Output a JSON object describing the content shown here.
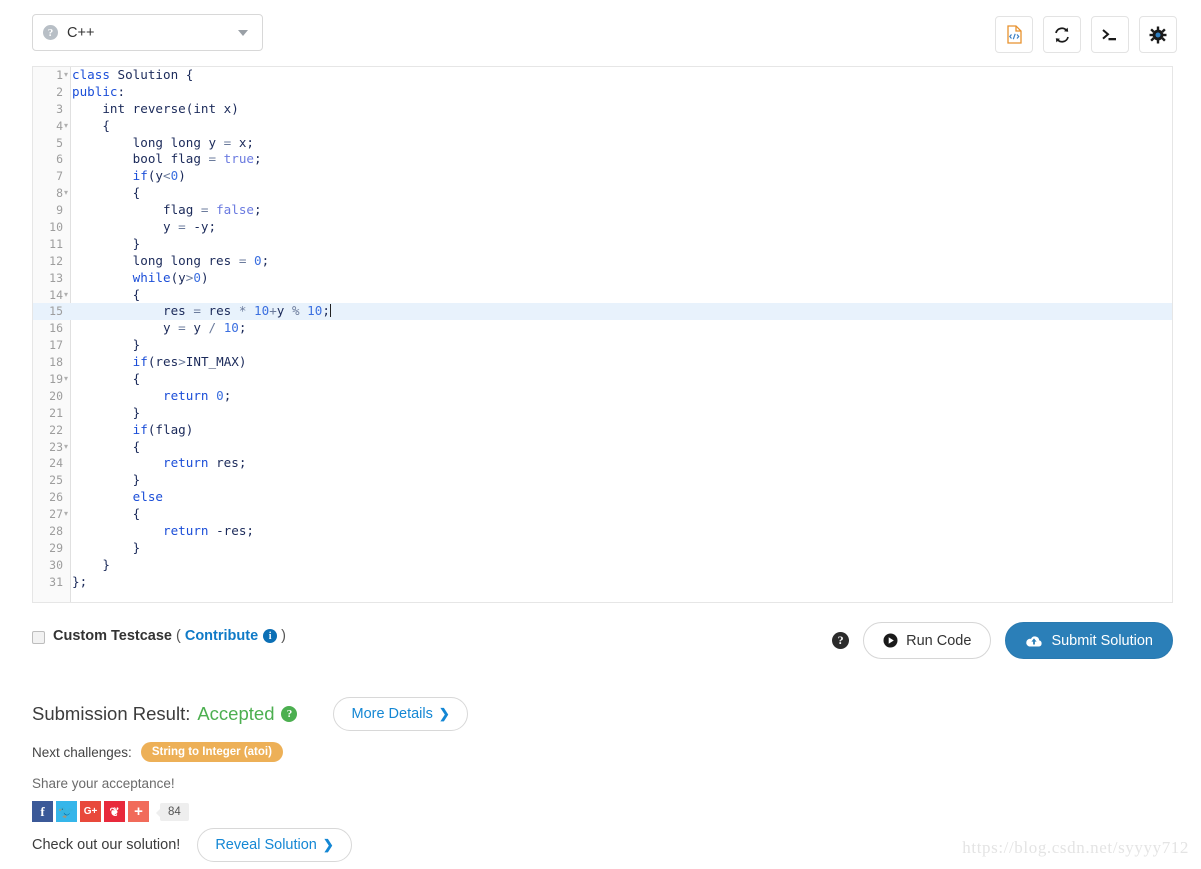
{
  "toolbar": {
    "language": {
      "selected": "C++",
      "help_icon": "help-circle-icon",
      "chevron": "chevron-down-icon"
    },
    "buttons": [
      {
        "name": "code-definition-button",
        "icon": "file-code-icon",
        "label": ""
      },
      {
        "name": "reset-code-button",
        "icon": "refresh-icon",
        "label": ""
      },
      {
        "name": "console-button",
        "icon": "terminal-icon",
        "label": ""
      },
      {
        "name": "settings-button",
        "icon": "gear-icon",
        "label": ""
      }
    ]
  },
  "editor": {
    "language": "cpp",
    "active_line": 15,
    "total_lines": 31,
    "fold_lines": [
      1,
      4,
      8,
      14,
      19,
      23,
      27
    ],
    "lines": [
      {
        "n": 1,
        "tokens": [
          {
            "t": "class",
            "c": "kw"
          },
          {
            "t": " Solution {",
            "c": "pl"
          }
        ]
      },
      {
        "n": 2,
        "tokens": [
          {
            "t": "public",
            "c": "kw"
          },
          {
            "t": ":",
            "c": "pl"
          }
        ]
      },
      {
        "n": 3,
        "tokens": [
          {
            "t": "    int reverse(int x)",
            "c": "pl"
          }
        ]
      },
      {
        "n": 4,
        "tokens": [
          {
            "t": "    {",
            "c": "pl"
          }
        ]
      },
      {
        "n": 5,
        "tokens": [
          {
            "t": "        long long y ",
            "c": "pl"
          },
          {
            "t": "=",
            "c": "op"
          },
          {
            "t": " x;",
            "c": "pl"
          }
        ]
      },
      {
        "n": 6,
        "tokens": [
          {
            "t": "        bool flag ",
            "c": "pl"
          },
          {
            "t": "=",
            "c": "op"
          },
          {
            "t": " ",
            "c": "pl"
          },
          {
            "t": "true",
            "c": "lit"
          },
          {
            "t": ";",
            "c": "pl"
          }
        ]
      },
      {
        "n": 7,
        "tokens": [
          {
            "t": "        ",
            "c": "pl"
          },
          {
            "t": "if",
            "c": "kw"
          },
          {
            "t": "(y",
            "c": "pl"
          },
          {
            "t": "<",
            "c": "op"
          },
          {
            "t": "0",
            "c": "num"
          },
          {
            "t": ")",
            "c": "pl"
          }
        ]
      },
      {
        "n": 8,
        "tokens": [
          {
            "t": "        {",
            "c": "pl"
          }
        ]
      },
      {
        "n": 9,
        "tokens": [
          {
            "t": "            flag ",
            "c": "pl"
          },
          {
            "t": "=",
            "c": "op"
          },
          {
            "t": " ",
            "c": "pl"
          },
          {
            "t": "false",
            "c": "lit"
          },
          {
            "t": ";",
            "c": "pl"
          }
        ]
      },
      {
        "n": 10,
        "tokens": [
          {
            "t": "            y ",
            "c": "pl"
          },
          {
            "t": "=",
            "c": "op"
          },
          {
            "t": " -y;",
            "c": "pl"
          }
        ]
      },
      {
        "n": 11,
        "tokens": [
          {
            "t": "        }",
            "c": "pl"
          }
        ]
      },
      {
        "n": 12,
        "tokens": [
          {
            "t": "        long long res ",
            "c": "pl"
          },
          {
            "t": "=",
            "c": "op"
          },
          {
            "t": " ",
            "c": "pl"
          },
          {
            "t": "0",
            "c": "num"
          },
          {
            "t": ";",
            "c": "pl"
          }
        ]
      },
      {
        "n": 13,
        "tokens": [
          {
            "t": "        ",
            "c": "pl"
          },
          {
            "t": "while",
            "c": "kw"
          },
          {
            "t": "(y",
            "c": "pl"
          },
          {
            "t": ">",
            "c": "op"
          },
          {
            "t": "0",
            "c": "num"
          },
          {
            "t": ")",
            "c": "pl"
          }
        ]
      },
      {
        "n": 14,
        "tokens": [
          {
            "t": "        {",
            "c": "pl"
          }
        ]
      },
      {
        "n": 15,
        "tokens": [
          {
            "t": "            res ",
            "c": "pl"
          },
          {
            "t": "=",
            "c": "op"
          },
          {
            "t": " res ",
            "c": "pl"
          },
          {
            "t": "*",
            "c": "op"
          },
          {
            "t": " ",
            "c": "pl"
          },
          {
            "t": "10",
            "c": "num"
          },
          {
            "t": "+",
            "c": "op"
          },
          {
            "t": "y ",
            "c": "pl"
          },
          {
            "t": "%",
            "c": "op"
          },
          {
            "t": " ",
            "c": "pl"
          },
          {
            "t": "10",
            "c": "num"
          },
          {
            "t": ";",
            "c": "pl"
          }
        ],
        "caret": true
      },
      {
        "n": 16,
        "tokens": [
          {
            "t": "            y ",
            "c": "pl"
          },
          {
            "t": "=",
            "c": "op"
          },
          {
            "t": " y ",
            "c": "pl"
          },
          {
            "t": "/",
            "c": "op"
          },
          {
            "t": " ",
            "c": "pl"
          },
          {
            "t": "10",
            "c": "num"
          },
          {
            "t": ";",
            "c": "pl"
          }
        ]
      },
      {
        "n": 17,
        "tokens": [
          {
            "t": "        }",
            "c": "pl"
          }
        ]
      },
      {
        "n": 18,
        "tokens": [
          {
            "t": "        ",
            "c": "pl"
          },
          {
            "t": "if",
            "c": "kw"
          },
          {
            "t": "(res",
            "c": "pl"
          },
          {
            "t": ">",
            "c": "op"
          },
          {
            "t": "INT_MAX)",
            "c": "pl"
          }
        ]
      },
      {
        "n": 19,
        "tokens": [
          {
            "t": "        {",
            "c": "pl"
          }
        ]
      },
      {
        "n": 20,
        "tokens": [
          {
            "t": "            ",
            "c": "pl"
          },
          {
            "t": "return",
            "c": "kw"
          },
          {
            "t": " ",
            "c": "pl"
          },
          {
            "t": "0",
            "c": "num"
          },
          {
            "t": ";",
            "c": "pl"
          }
        ]
      },
      {
        "n": 21,
        "tokens": [
          {
            "t": "        }",
            "c": "pl"
          }
        ]
      },
      {
        "n": 22,
        "tokens": [
          {
            "t": "        ",
            "c": "pl"
          },
          {
            "t": "if",
            "c": "kw"
          },
          {
            "t": "(flag)",
            "c": "pl"
          }
        ]
      },
      {
        "n": 23,
        "tokens": [
          {
            "t": "        {",
            "c": "pl"
          }
        ]
      },
      {
        "n": 24,
        "tokens": [
          {
            "t": "            ",
            "c": "pl"
          },
          {
            "t": "return",
            "c": "kw"
          },
          {
            "t": " res;",
            "c": "pl"
          }
        ]
      },
      {
        "n": 25,
        "tokens": [
          {
            "t": "        }",
            "c": "pl"
          }
        ]
      },
      {
        "n": 26,
        "tokens": [
          {
            "t": "        ",
            "c": "pl"
          },
          {
            "t": "else",
            "c": "kw"
          }
        ]
      },
      {
        "n": 27,
        "tokens": [
          {
            "t": "        {",
            "c": "pl"
          }
        ]
      },
      {
        "n": 28,
        "tokens": [
          {
            "t": "            ",
            "c": "pl"
          },
          {
            "t": "return",
            "c": "kw"
          },
          {
            "t": " -res;",
            "c": "pl"
          }
        ]
      },
      {
        "n": 29,
        "tokens": [
          {
            "t": "        }",
            "c": "pl"
          }
        ]
      },
      {
        "n": 30,
        "tokens": [
          {
            "t": "    }",
            "c": "pl"
          }
        ]
      },
      {
        "n": 31,
        "tokens": [
          {
            "t": "};",
            "c": "pl"
          }
        ]
      }
    ]
  },
  "testcase": {
    "checked": false,
    "label": "Custom Testcase",
    "open_paren": "(",
    "contribute_label": "Contribute",
    "contribute_icon": "info-circle-icon",
    "close_paren": ")"
  },
  "actions": {
    "help_icon": "help-circle-icon",
    "run_label": "Run Code",
    "run_icon": "play-circle-icon",
    "submit_label": "Submit Solution",
    "submit_icon": "cloud-upload-icon"
  },
  "result": {
    "label": "Submission Result:",
    "value": "Accepted",
    "help_icon": "help-circle-icon",
    "more_details_label": "More Details",
    "more_details_chevron": "❯"
  },
  "next_challenges": {
    "label": "Next challenges:",
    "items": [
      "String to Integer (atoi)"
    ]
  },
  "share": {
    "title": "Share your acceptance!",
    "buttons": [
      {
        "name": "share-facebook-button",
        "glyph": "f",
        "cls": "s-fb",
        "icon": "facebook-icon"
      },
      {
        "name": "share-twitter-button",
        "glyph": "🐦",
        "cls": "s-tw",
        "icon": "twitter-icon"
      },
      {
        "name": "share-googleplus-button",
        "glyph": "G+",
        "cls": "s-gp",
        "icon": "google-plus-icon"
      },
      {
        "name": "share-weibo-button",
        "glyph": "❦",
        "cls": "s-wb",
        "icon": "weibo-icon"
      },
      {
        "name": "share-more-button",
        "glyph": "+",
        "cls": "s-pl",
        "icon": "plus-icon"
      }
    ],
    "count": "84"
  },
  "solution": {
    "label": "Check out our solution!",
    "button_label": "Reveal Solution",
    "button_chevron": "❯"
  },
  "watermark": "https://blog.csdn.net/syyyy712",
  "colors": {
    "accent_blue": "#2b7fb8",
    "link_blue": "#1487d4",
    "accepted_green": "#4caf50",
    "badge_orange": "#edb057",
    "active_line": "#e8f2fc"
  }
}
